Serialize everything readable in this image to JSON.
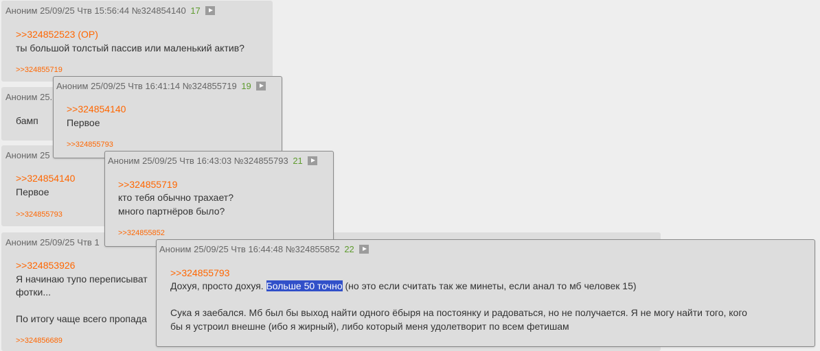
{
  "posts": [
    {
      "author": "Аноним",
      "date": "25/09/25 Чтв 15:56:44",
      "number": "№324854140",
      "count": "17",
      "reply": ">>324852523 (OP)",
      "lines": [
        "ты большой толстый пассив или маленький актив?"
      ],
      "backref": ">>324855719"
    },
    {
      "author": "Аноним",
      "date_partial": "25.",
      "lines": [
        "бамп"
      ]
    },
    {
      "author": "Аноним",
      "date_partial": "25",
      "reply": ">>324854140",
      "lines": [
        "Первое"
      ],
      "backref": ">>324855793"
    },
    {
      "author": "Аноним",
      "date_partial": "25/09/25 Чтв 1",
      "reply": ">>324853926",
      "lines": [
        "Я начинаю тупо переписыват",
        "фотки...",
        "По итогу чаще всего пропада"
      ],
      "backref": ">>324856689"
    }
  ],
  "popups": [
    {
      "author": "Аноним",
      "date": "25/09/25 Чтв 16:41:14",
      "number": "№324855719",
      "count": "19",
      "reply": ">>324854140",
      "lines": [
        "Первое"
      ],
      "backref": ">>324855793"
    },
    {
      "author": "Аноним",
      "date": "25/09/25 Чтв 16:43:03",
      "number": "№324855793",
      "count": "21",
      "reply": ">>324855719",
      "lines": [
        "кто тебя обычно трахает?",
        "много партнёров было?"
      ],
      "backref": ">>324855852"
    },
    {
      "author": "Аноним",
      "date": "25/09/25 Чтв 16:44:48",
      "number": "№324855852",
      "count": "22",
      "reply": ">>324855793",
      "line1_before": "Дохуя, просто дохуя. ",
      "line1_selected": "Больше 50 точно",
      "line1_after": " (но это если считать так же минеты, если анал то мб человек 15)",
      "line2": "Сука я заебался. Мб был бы выход найти одного ёбыря на постоянку и радоваться, но не получается. Я не могу найти того, кого",
      "line3": "бы я устроил внешне (ибо я жирный), либо который меня удолетворит по всем фетишам"
    }
  ],
  "colors": {
    "link": "#ff6600",
    "count": "#5e9b2e",
    "selection": "#3150c9"
  },
  "icons": {
    "expand": "play-icon"
  }
}
